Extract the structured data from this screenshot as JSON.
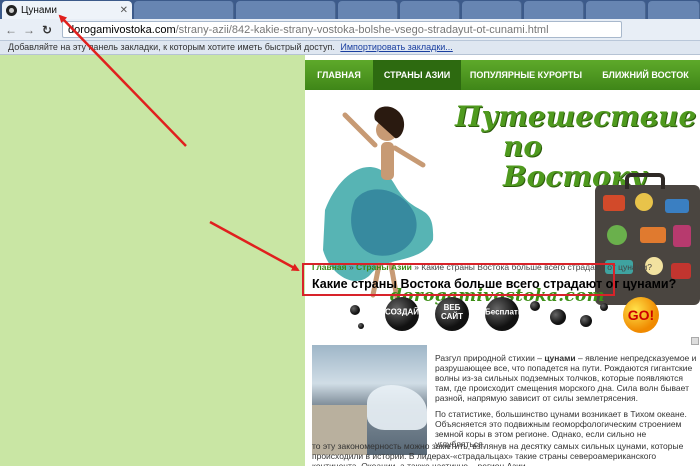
{
  "browser": {
    "active_tab_title": "Цунами",
    "url_host": "dorogamivostoka.com",
    "url_path": "/strany-azii/842-kakie-strany-vostoka-bolshe-vsego-stradayut-ot-cunami.html",
    "bookmarks_prompt": "Добавляйте на эту панель закладки, к которым хотите иметь быстрый доступ.",
    "bookmarks_import": "Импортировать закладки..."
  },
  "nav": {
    "items": [
      "ГЛАВНАЯ",
      "СТРАНЫ АЗИИ",
      "ПОПУЛЯРНЫЕ КУРОРТЫ",
      "БЛИЖНИЙ ВОСТОК"
    ],
    "active_index": 1
  },
  "header": {
    "slogan_line1": "Путешествие",
    "slogan_line2": "по Востоку",
    "sitename": "dorogamivostoka.com"
  },
  "breadcrumb": {
    "home": "Главная",
    "sep": " » ",
    "section": "Страны Азии",
    "current": "Какие страны Востока больше всего страдают от цунами?"
  },
  "page_title": "Какие страны Востока больше всего страдают от цунами?",
  "ad": {
    "labels": [
      "СОЗДАЙ",
      "ВЕБ САЙТ",
      "Бесплатно"
    ],
    "go": "GO!"
  },
  "article": {
    "p1_a": "Разгул природной стихии – ",
    "p1_bold": "цунами",
    "p1_b": " – явление непредсказуемое и разрушающее все, что попадется на пути. Рождаются гигантские волны из-за сильных подземных толчков, которые появляются там, где происходит смещения морского дна. Сила волн бывает разной, напрямую зависит от силы землетрясения.",
    "p2": "По статистике, большинство цунами возникает в Тихом океане. Объясняется это подвижным геоморфологическим строением земной коры в этом регионе. Однако, если сильно не углубляться,",
    "p3": "то эту закономерность можно заметить, взглянув на десятку самых сильных цунами, которые происходили в истории. В лидерах-«страдальцах» такие страны североамериканского континента, Океании, а также частично – регион Азии."
  },
  "colors": {
    "nav_green": "#4f9a1e",
    "highlight_red": "#d8232a",
    "page_bg": "#c9e6a4"
  }
}
